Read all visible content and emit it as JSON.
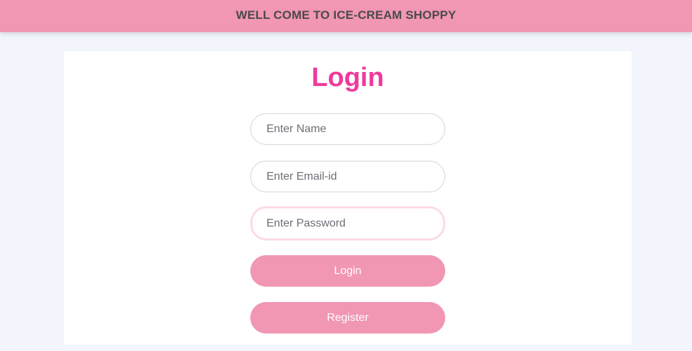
{
  "header": {
    "title": "WELL COME TO ICE-CREAM SHOPPY"
  },
  "login_form": {
    "heading": "Login",
    "name_placeholder": "Enter Name",
    "email_placeholder": "Enter Email-id",
    "password_placeholder": "Enter Password",
    "login_label": "Login",
    "register_label": "Register"
  },
  "colors": {
    "brand_pink": "#f196b3",
    "heading_pink": "#ef3a9a",
    "page_background": "#f3f5fd"
  }
}
